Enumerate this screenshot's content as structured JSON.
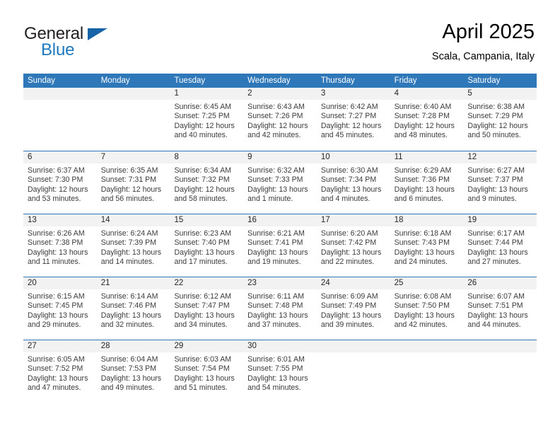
{
  "brand": {
    "name_top": "General",
    "name_bottom": "Blue",
    "logo_icon": "triangle-logo-icon"
  },
  "header": {
    "title": "April 2025",
    "subtitle": "Scala, Campania, Italy"
  },
  "weekdays": [
    "Sunday",
    "Monday",
    "Tuesday",
    "Wednesday",
    "Thursday",
    "Friday",
    "Saturday"
  ],
  "colors": {
    "header_blue": "#2e77b8",
    "brand_blue": "#1e7ac0",
    "day_band_gray": "#f2f2f2",
    "text": "#3b3b3b"
  },
  "weeks": [
    [
      {
        "day": "",
        "lines": []
      },
      {
        "day": "",
        "lines": []
      },
      {
        "day": "1",
        "lines": [
          "Sunrise: 6:45 AM",
          "Sunset: 7:25 PM",
          "Daylight: 12 hours",
          "and 40 minutes."
        ]
      },
      {
        "day": "2",
        "lines": [
          "Sunrise: 6:43 AM",
          "Sunset: 7:26 PM",
          "Daylight: 12 hours",
          "and 42 minutes."
        ]
      },
      {
        "day": "3",
        "lines": [
          "Sunrise: 6:42 AM",
          "Sunset: 7:27 PM",
          "Daylight: 12 hours",
          "and 45 minutes."
        ]
      },
      {
        "day": "4",
        "lines": [
          "Sunrise: 6:40 AM",
          "Sunset: 7:28 PM",
          "Daylight: 12 hours",
          "and 48 minutes."
        ]
      },
      {
        "day": "5",
        "lines": [
          "Sunrise: 6:38 AM",
          "Sunset: 7:29 PM",
          "Daylight: 12 hours",
          "and 50 minutes."
        ]
      }
    ],
    [
      {
        "day": "6",
        "lines": [
          "Sunrise: 6:37 AM",
          "Sunset: 7:30 PM",
          "Daylight: 12 hours",
          "and 53 minutes."
        ]
      },
      {
        "day": "7",
        "lines": [
          "Sunrise: 6:35 AM",
          "Sunset: 7:31 PM",
          "Daylight: 12 hours",
          "and 56 minutes."
        ]
      },
      {
        "day": "8",
        "lines": [
          "Sunrise: 6:34 AM",
          "Sunset: 7:32 PM",
          "Daylight: 12 hours",
          "and 58 minutes."
        ]
      },
      {
        "day": "9",
        "lines": [
          "Sunrise: 6:32 AM",
          "Sunset: 7:33 PM",
          "Daylight: 13 hours",
          "and 1 minute."
        ]
      },
      {
        "day": "10",
        "lines": [
          "Sunrise: 6:30 AM",
          "Sunset: 7:34 PM",
          "Daylight: 13 hours",
          "and 4 minutes."
        ]
      },
      {
        "day": "11",
        "lines": [
          "Sunrise: 6:29 AM",
          "Sunset: 7:36 PM",
          "Daylight: 13 hours",
          "and 6 minutes."
        ]
      },
      {
        "day": "12",
        "lines": [
          "Sunrise: 6:27 AM",
          "Sunset: 7:37 PM",
          "Daylight: 13 hours",
          "and 9 minutes."
        ]
      }
    ],
    [
      {
        "day": "13",
        "lines": [
          "Sunrise: 6:26 AM",
          "Sunset: 7:38 PM",
          "Daylight: 13 hours",
          "and 11 minutes."
        ]
      },
      {
        "day": "14",
        "lines": [
          "Sunrise: 6:24 AM",
          "Sunset: 7:39 PM",
          "Daylight: 13 hours",
          "and 14 minutes."
        ]
      },
      {
        "day": "15",
        "lines": [
          "Sunrise: 6:23 AM",
          "Sunset: 7:40 PM",
          "Daylight: 13 hours",
          "and 17 minutes."
        ]
      },
      {
        "day": "16",
        "lines": [
          "Sunrise: 6:21 AM",
          "Sunset: 7:41 PM",
          "Daylight: 13 hours",
          "and 19 minutes."
        ]
      },
      {
        "day": "17",
        "lines": [
          "Sunrise: 6:20 AM",
          "Sunset: 7:42 PM",
          "Daylight: 13 hours",
          "and 22 minutes."
        ]
      },
      {
        "day": "18",
        "lines": [
          "Sunrise: 6:18 AM",
          "Sunset: 7:43 PM",
          "Daylight: 13 hours",
          "and 24 minutes."
        ]
      },
      {
        "day": "19",
        "lines": [
          "Sunrise: 6:17 AM",
          "Sunset: 7:44 PM",
          "Daylight: 13 hours",
          "and 27 minutes."
        ]
      }
    ],
    [
      {
        "day": "20",
        "lines": [
          "Sunrise: 6:15 AM",
          "Sunset: 7:45 PM",
          "Daylight: 13 hours",
          "and 29 minutes."
        ]
      },
      {
        "day": "21",
        "lines": [
          "Sunrise: 6:14 AM",
          "Sunset: 7:46 PM",
          "Daylight: 13 hours",
          "and 32 minutes."
        ]
      },
      {
        "day": "22",
        "lines": [
          "Sunrise: 6:12 AM",
          "Sunset: 7:47 PM",
          "Daylight: 13 hours",
          "and 34 minutes."
        ]
      },
      {
        "day": "23",
        "lines": [
          "Sunrise: 6:11 AM",
          "Sunset: 7:48 PM",
          "Daylight: 13 hours",
          "and 37 minutes."
        ]
      },
      {
        "day": "24",
        "lines": [
          "Sunrise: 6:09 AM",
          "Sunset: 7:49 PM",
          "Daylight: 13 hours",
          "and 39 minutes."
        ]
      },
      {
        "day": "25",
        "lines": [
          "Sunrise: 6:08 AM",
          "Sunset: 7:50 PM",
          "Daylight: 13 hours",
          "and 42 minutes."
        ]
      },
      {
        "day": "26",
        "lines": [
          "Sunrise: 6:07 AM",
          "Sunset: 7:51 PM",
          "Daylight: 13 hours",
          "and 44 minutes."
        ]
      }
    ],
    [
      {
        "day": "27",
        "lines": [
          "Sunrise: 6:05 AM",
          "Sunset: 7:52 PM",
          "Daylight: 13 hours",
          "and 47 minutes."
        ]
      },
      {
        "day": "28",
        "lines": [
          "Sunrise: 6:04 AM",
          "Sunset: 7:53 PM",
          "Daylight: 13 hours",
          "and 49 minutes."
        ]
      },
      {
        "day": "29",
        "lines": [
          "Sunrise: 6:03 AM",
          "Sunset: 7:54 PM",
          "Daylight: 13 hours",
          "and 51 minutes."
        ]
      },
      {
        "day": "30",
        "lines": [
          "Sunrise: 6:01 AM",
          "Sunset: 7:55 PM",
          "Daylight: 13 hours",
          "and 54 minutes."
        ]
      },
      {
        "day": "",
        "lines": []
      },
      {
        "day": "",
        "lines": []
      },
      {
        "day": "",
        "lines": []
      }
    ]
  ]
}
